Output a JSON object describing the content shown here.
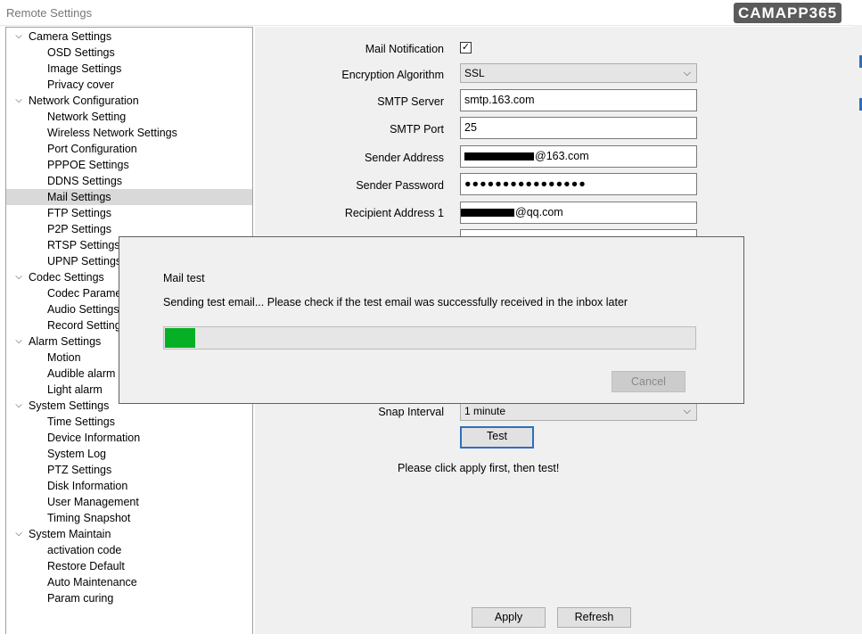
{
  "window": {
    "title": "Remote Settings",
    "watermark": "CAMAPP365"
  },
  "tree": [
    {
      "label": "Camera Settings",
      "level": 0,
      "expanded": true
    },
    {
      "label": "OSD Settings",
      "level": 1
    },
    {
      "label": "Image Settings",
      "level": 1
    },
    {
      "label": "Privacy cover",
      "level": 1
    },
    {
      "label": "Network Configuration",
      "level": 0,
      "expanded": true
    },
    {
      "label": "Network Setting",
      "level": 1
    },
    {
      "label": "Wireless Network Settings",
      "level": 1
    },
    {
      "label": "Port Configuration",
      "level": 1
    },
    {
      "label": "PPPOE Settings",
      "level": 1
    },
    {
      "label": "DDNS Settings",
      "level": 1
    },
    {
      "label": "Mail Settings",
      "level": 1,
      "selected": true
    },
    {
      "label": "FTP Settings",
      "level": 1
    },
    {
      "label": "P2P Settings",
      "level": 1
    },
    {
      "label": "RTSP Settings",
      "level": 1
    },
    {
      "label": "UPNP Settings",
      "level": 1
    },
    {
      "label": "Codec Settings",
      "level": 0,
      "expanded": true
    },
    {
      "label": "Codec Parame",
      "level": 1
    },
    {
      "label": "Audio Settings",
      "level": 1
    },
    {
      "label": "Record Setting",
      "level": 1
    },
    {
      "label": "Alarm Settings",
      "level": 0,
      "expanded": true
    },
    {
      "label": "Motion",
      "level": 1
    },
    {
      "label": "Audible alarm",
      "level": 1
    },
    {
      "label": "Light alarm",
      "level": 1
    },
    {
      "label": "System Settings",
      "level": 0,
      "expanded": true
    },
    {
      "label": "Time Settings",
      "level": 1
    },
    {
      "label": "Device Information",
      "level": 1
    },
    {
      "label": "System Log",
      "level": 1
    },
    {
      "label": "PTZ Settings",
      "level": 1
    },
    {
      "label": "Disk Information",
      "level": 1
    },
    {
      "label": "User Management",
      "level": 1
    },
    {
      "label": "Timing Snapshot",
      "level": 1
    },
    {
      "label": "System Maintain",
      "level": 0,
      "expanded": true
    },
    {
      "label": "activation code",
      "level": 1
    },
    {
      "label": "Restore Default",
      "level": 1
    },
    {
      "label": "Auto Maintenance",
      "level": 1
    },
    {
      "label": "Param curing",
      "level": 1
    }
  ],
  "form": {
    "mail_notification_label": "Mail Notification",
    "mail_notification_checked": true,
    "encryption_label": "Encryption Algorithm",
    "encryption_value": "SSL",
    "smtp_server_label": "SMTP Server",
    "smtp_server_value": "smtp.163.com",
    "smtp_port_label": "SMTP Port",
    "smtp_port_value": "25",
    "sender_address_label": "Sender Address",
    "sender_address_suffix": "@163.com",
    "sender_password_label": "Sender Password",
    "sender_password_value": "●●●●●●●●●●●●●●●●",
    "recipient1_label": "Recipient Address 1",
    "recipient1_suffix": "@qq.com",
    "snap_interval_label": "Snap Interval",
    "snap_interval_value": "1 minute",
    "test_button": "Test",
    "hint": "Please click apply first, then test!",
    "apply_button": "Apply",
    "refresh_button": "Refresh"
  },
  "dialog": {
    "title": "Mail test",
    "message": "Sending test email... Please check if the test email was successfully received in the inbox later",
    "progress_fraction": 0.06,
    "cancel_button": "Cancel"
  },
  "colors": {
    "progress": "#06b025",
    "selection": "#d9d9d9",
    "focus_border": "#2f6fbf"
  }
}
